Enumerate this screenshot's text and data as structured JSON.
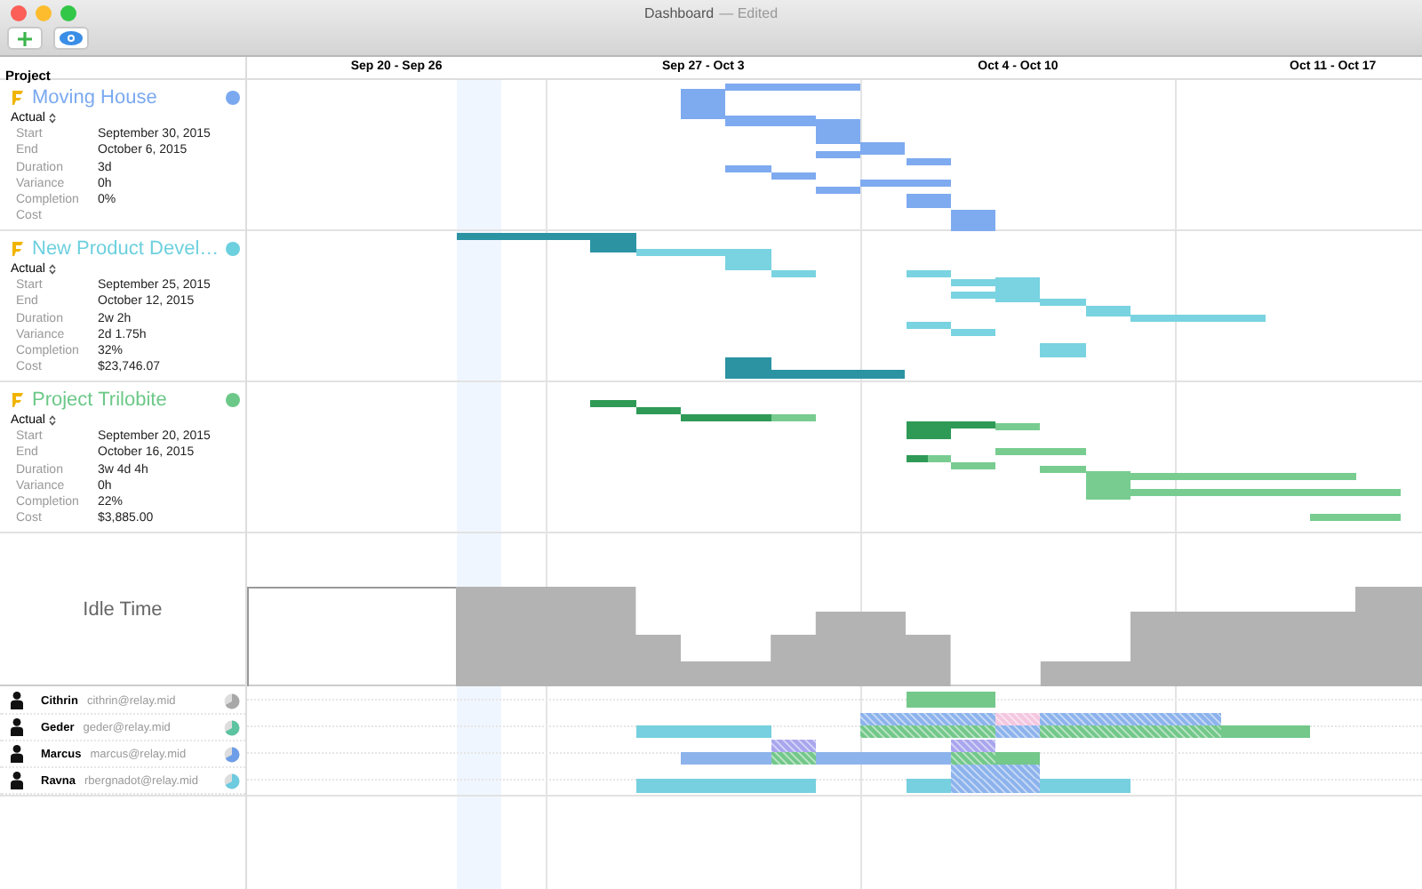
{
  "window": {
    "title": "Dashboard",
    "subtitle": "— Edited"
  },
  "toolbar": {
    "buttons": [
      {
        "kind": "add"
      },
      {
        "kind": "view"
      }
    ]
  },
  "header": {
    "column": "Project",
    "weeks": [
      "Sep 20 - Sep 26",
      "Sep 27 - Oct 3",
      "Oct 4 - Oct 10",
      "Oct 11 - Oct 17"
    ]
  },
  "projects": [
    {
      "name": "Moving House",
      "color": "#7aa9f0",
      "mode": "Actual",
      "fields": [
        {
          "label": "Start",
          "value": "September 30, 2015"
        },
        {
          "label": "End",
          "value": "October 6, 2015"
        },
        {
          "label": "Duration",
          "value": "3d"
        },
        {
          "label": "Variance",
          "value": "0h"
        },
        {
          "label": "Completion",
          "value": "0%"
        },
        {
          "label": "Cost"
        }
      ]
    },
    {
      "name": "New Product Devel…",
      "color": "#6dd0de",
      "mode": "Actual",
      "fields": [
        {
          "label": "Start",
          "value": "September 25, 2015"
        },
        {
          "label": "End",
          "value": "October 12, 2015"
        },
        {
          "label": "Duration",
          "value": "2w 2h"
        },
        {
          "label": "Variance",
          "value": "2d 1.75h"
        },
        {
          "label": "Completion",
          "value": "32%"
        },
        {
          "label": "Cost",
          "value": "$23,746.07"
        }
      ]
    },
    {
      "name": "Project Trilobite",
      "color": "#6cc888",
      "mode": "Actual",
      "fields": [
        {
          "label": "Start",
          "value": "September 20, 2015"
        },
        {
          "label": "End",
          "value": "October 16, 2015"
        },
        {
          "label": "Duration",
          "value": "3w 4d 4h"
        },
        {
          "label": "Variance",
          "value": "0h"
        },
        {
          "label": "Completion",
          "value": "22%"
        },
        {
          "label": "Cost",
          "value": "$3,885.00"
        }
      ]
    }
  ],
  "idle": {
    "label": "Idle Time"
  },
  "resources": [
    {
      "name": "Cithrin",
      "email": "cithrin@relay.mid",
      "color": "#a8a8a8"
    },
    {
      "name": "Geder",
      "email": "geder@relay.mid",
      "color": "#5cc4a0"
    },
    {
      "name": "Marcus",
      "email": "marcus@relay.mid",
      "color": "#6f9ee8"
    },
    {
      "name": "Ravna",
      "email": "rbergnadot@relay.mid",
      "color": "#6dcbe0"
    }
  ]
}
